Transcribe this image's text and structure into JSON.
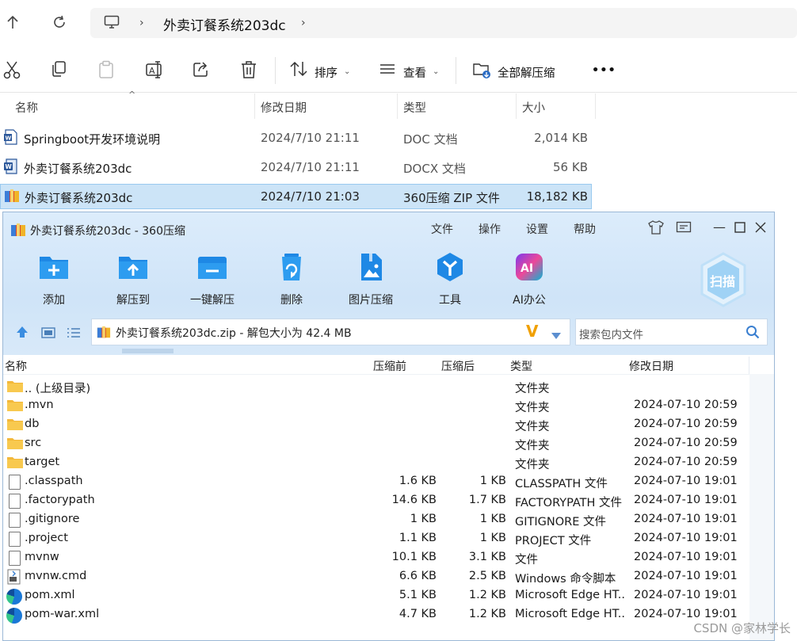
{
  "explorer": {
    "breadcrumb": "外卖订餐系统203dc",
    "toolbar": {
      "sort_label": "排序",
      "view_label": "查看",
      "extract_all_label": "全部解压缩",
      "more_label": "•••"
    },
    "columns": {
      "name": "名称",
      "date": "修改日期",
      "type": "类型",
      "size": "大小"
    },
    "files": [
      {
        "name": "Springboot开发环境说明",
        "date": "2024/7/10 21:11",
        "type": "DOC 文档",
        "size": "2,014 KB",
        "icon": "word-doc-icon"
      },
      {
        "name": "外卖订餐系统203dc",
        "date": "2024/7/10 21:11",
        "type": "DOCX 文档",
        "size": "56 KB",
        "icon": "word-docx-icon"
      },
      {
        "name": "外卖订餐系统203dc",
        "date": "2024/7/10 21:03",
        "type": "360压缩 ZIP 文件",
        "size": "18,182 KB",
        "icon": "zip-archive-icon",
        "selected": true
      }
    ]
  },
  "zip": {
    "title": "外卖订餐系统203dc - 360压缩",
    "menu": [
      "文件",
      "操作",
      "设置",
      "帮助"
    ],
    "buttons": [
      "添加",
      "解压到",
      "一键解压",
      "删除",
      "图片压缩",
      "工具",
      "AI办公"
    ],
    "scan_label": "扫描",
    "path_text": "外卖订餐系统203dc.zip - 解包大小为 42.4 MB",
    "search_placeholder": "搜索包内文件",
    "columns": {
      "name": "名称",
      "before": "压缩前",
      "after": "压缩后",
      "type": "类型",
      "date": "修改日期"
    },
    "rows": [
      {
        "name": ".. (上级目录)",
        "before": "",
        "after": "",
        "type": "文件夹",
        "date": "",
        "icon": "folder"
      },
      {
        "name": ".mvn",
        "before": "",
        "after": "",
        "type": "文件夹",
        "date": "2024-07-10 20:59",
        "icon": "folder"
      },
      {
        "name": "db",
        "before": "",
        "after": "",
        "type": "文件夹",
        "date": "2024-07-10 20:59",
        "icon": "folder"
      },
      {
        "name": "src",
        "before": "",
        "after": "",
        "type": "文件夹",
        "date": "2024-07-10 20:59",
        "icon": "folder"
      },
      {
        "name": "target",
        "before": "",
        "after": "",
        "type": "文件夹",
        "date": "2024-07-10 20:59",
        "icon": "folder"
      },
      {
        "name": ".classpath",
        "before": "1.6 KB",
        "after": "1 KB",
        "type": "CLASSPATH 文件",
        "date": "2024-07-10 19:01",
        "icon": "file"
      },
      {
        "name": ".factorypath",
        "before": "14.6 KB",
        "after": "1.7 KB",
        "type": "FACTORYPATH 文件",
        "date": "2024-07-10 19:01",
        "icon": "file"
      },
      {
        "name": ".gitignore",
        "before": "1 KB",
        "after": "1 KB",
        "type": "GITIGNORE 文件",
        "date": "2024-07-10 19:01",
        "icon": "file"
      },
      {
        "name": ".project",
        "before": "1.1 KB",
        "after": "1 KB",
        "type": "PROJECT 文件",
        "date": "2024-07-10 19:01",
        "icon": "file"
      },
      {
        "name": "mvnw",
        "before": "10.1 KB",
        "after": "3.1 KB",
        "type": "文件",
        "date": "2024-07-10 19:01",
        "icon": "file"
      },
      {
        "name": "mvnw.cmd",
        "before": "6.6 KB",
        "after": "2.5 KB",
        "type": "Windows 命令脚本",
        "date": "2024-07-10 19:01",
        "icon": "cmd"
      },
      {
        "name": "pom.xml",
        "before": "5.1 KB",
        "after": "1.2 KB",
        "type": "Microsoft Edge HT...",
        "date": "2024-07-10 19:01",
        "icon": "edge"
      },
      {
        "name": "pom-war.xml",
        "before": "4.7 KB",
        "after": "1.2 KB",
        "type": "Microsoft Edge HT...",
        "date": "2024-07-10 19:01",
        "icon": "edge"
      }
    ]
  },
  "watermark": "CSDN @家林学长"
}
